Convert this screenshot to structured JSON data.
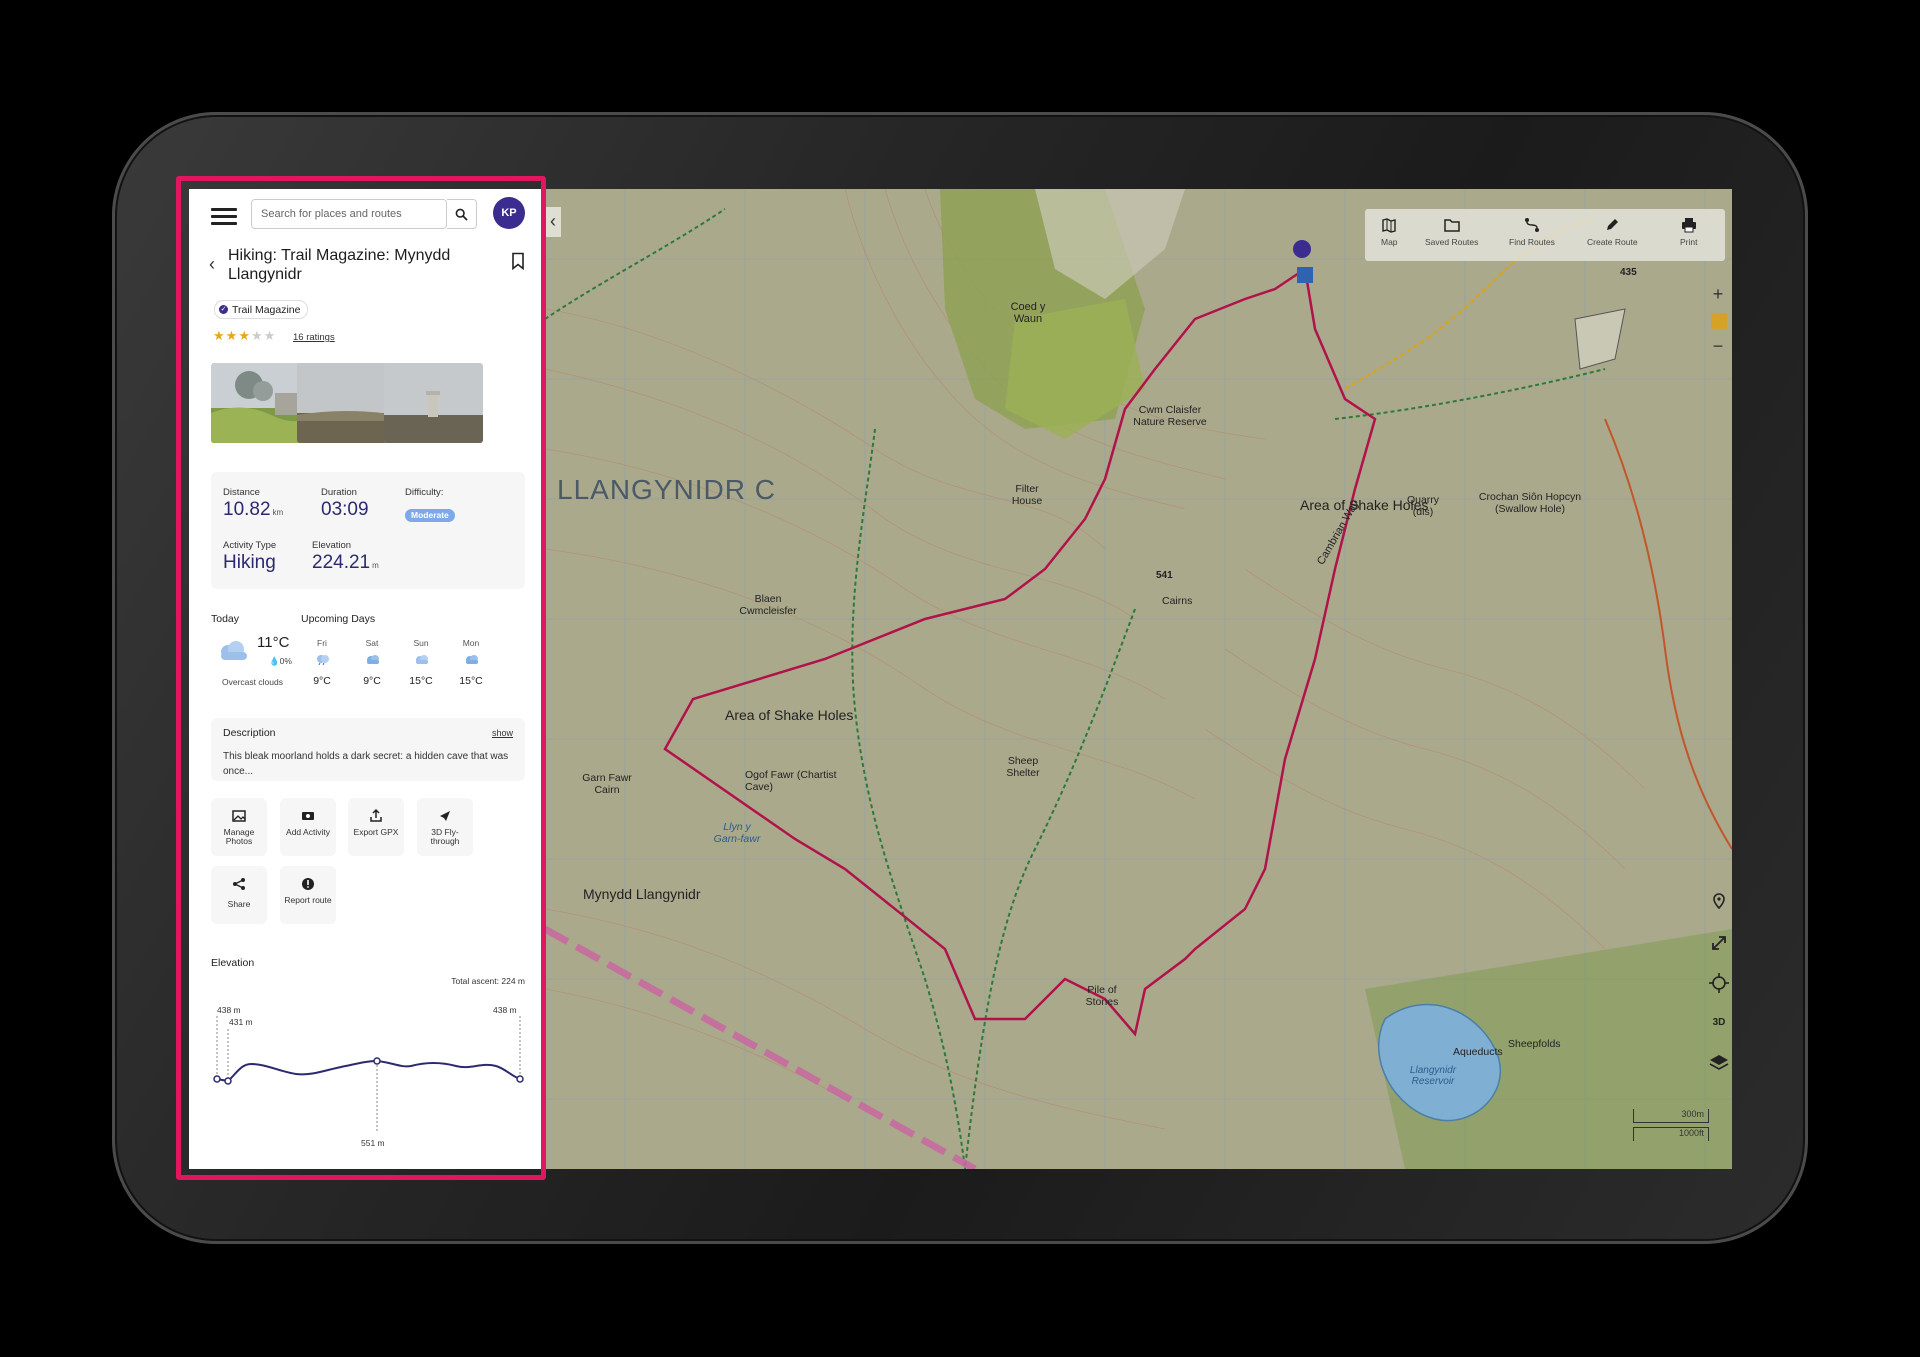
{
  "header": {
    "search_placeholder": "Search for places and routes",
    "avatar_initials": "KP"
  },
  "route": {
    "title": "Hiking: Trail Magazine: Mynydd Llangynidr",
    "publisher": "Trail Magazine",
    "rating_stars": 3,
    "ratings_text": "16 ratings"
  },
  "stats": {
    "distance_label": "Distance",
    "distance_value": "10.82",
    "distance_unit": "km",
    "duration_label": "Duration",
    "duration_value": "03:09",
    "difficulty_label": "Difficulty:",
    "difficulty_value": "Moderate",
    "activity_label": "Activity Type",
    "activity_value": "Hiking",
    "elevation_label": "Elevation",
    "elevation_value": "224.21",
    "elevation_unit": "m"
  },
  "weather": {
    "today_label": "Today",
    "upcoming_label": "Upcoming Days",
    "today_temp": "11°C",
    "today_precip": "0%",
    "today_desc": "Overcast clouds",
    "days": [
      {
        "day": "Fri",
        "temp": "9°C"
      },
      {
        "day": "Sat",
        "temp": "9°C"
      },
      {
        "day": "Sun",
        "temp": "15°C"
      },
      {
        "day": "Mon",
        "temp": "15°C"
      }
    ]
  },
  "description": {
    "label": "Description",
    "show_label": "show",
    "text": "This bleak moorland holds a dark secret: a hidden cave that was once..."
  },
  "actions": {
    "manage_photos": "Manage Photos",
    "add_activity": "Add Activity",
    "export_gpx": "Export GPX",
    "fly_through": "3D Fly-through",
    "share": "Share",
    "report_route": "Report route"
  },
  "elevation_profile": {
    "label": "Elevation",
    "total_ascent": "Total ascent: 224 m",
    "start_label": "438 m",
    "min_label": "431 m",
    "end_label": "438 m",
    "peak_label": "551 m"
  },
  "map_toolbar": {
    "map": "Map",
    "saved_routes": "Saved Routes",
    "find_routes": "Find Routes",
    "create_route": "Create Route",
    "print": "Print"
  },
  "map": {
    "zoom_in": "+",
    "zoom_out": "−",
    "ctrl_3d": "3D",
    "scale_metric": "300m",
    "scale_imperial": "1000ft",
    "labels": {
      "llangynidr": "LLANGYNIDR C",
      "shake_holes_west": "Area of Shake Holes",
      "shake_holes_north": "Area of Shake Holes",
      "mynydd": "Mynydd Llangynidr",
      "reservoir": "Llangynidr Reservoir",
      "coed": "Coed y Waun",
      "cwm_claisfer": "Cwm Claisfer Nature Reserve",
      "filter_house": "Filter House",
      "ogof": "Ogof Fawr (Chartist Cave)",
      "blaen": "Blaen Cwmcleisfer",
      "quarry": "Quarry (dis)",
      "crochan": "Crochan Siôn Hopcyn (Swallow Hole)",
      "cairns": "Cairns",
      "pile": "Pile of Stones",
      "sheep": "Sheep Shelter",
      "aqueducts": "Aqueducts",
      "sheepfolds": "Sheepfolds",
      "garn_fawr": "Garn Fawr Cairn",
      "llyn": "Llyn y Garn-fawr",
      "cambrian": "Cambrian Way",
      "spot_height": "541",
      "spot_435": "435"
    }
  },
  "colors": {
    "brand": "#3b2d8f",
    "route": "#b0134a",
    "highlight": "#e0175f",
    "difficulty": "#7da9e8",
    "star": "#e6a817"
  }
}
